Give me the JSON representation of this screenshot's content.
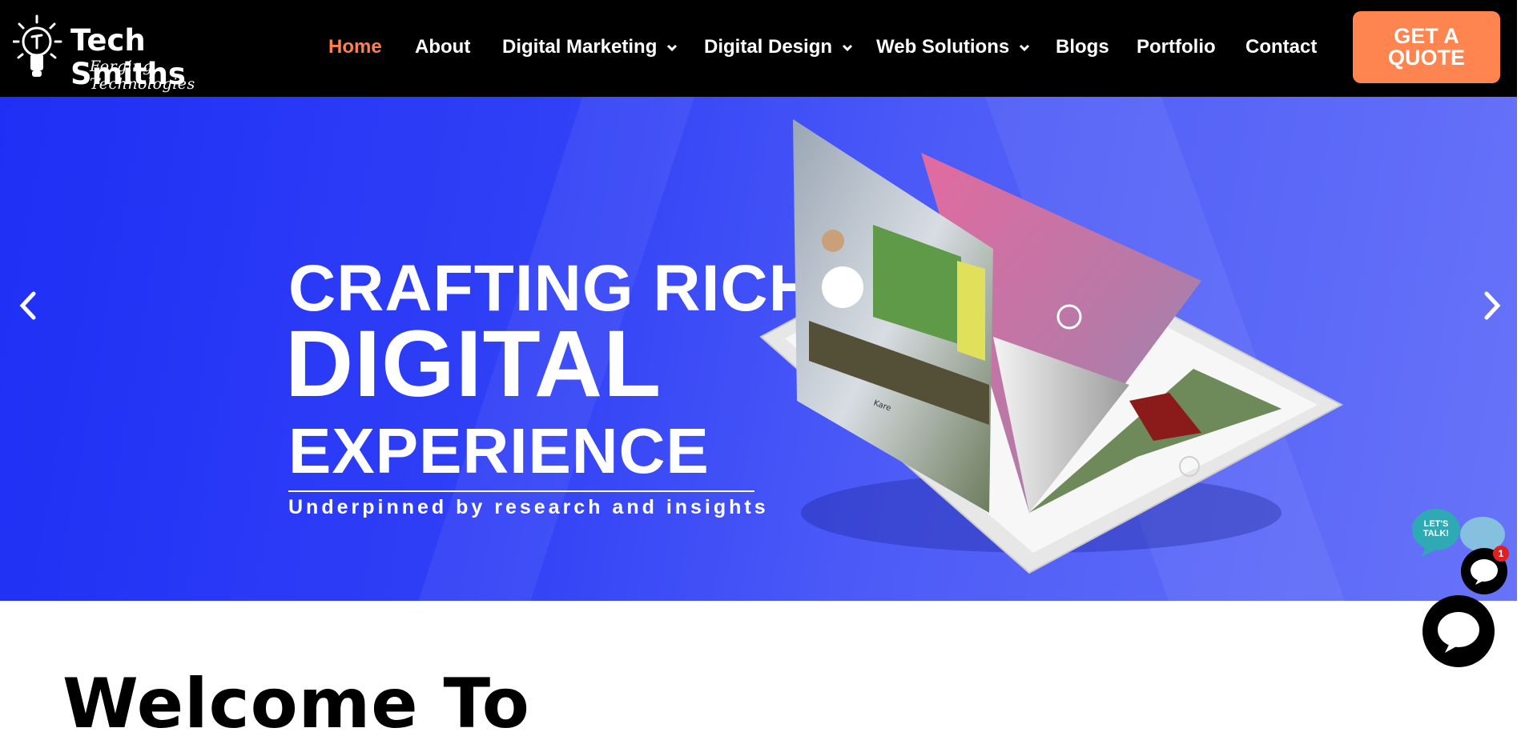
{
  "brand": {
    "name": "Tech Smiths",
    "tagline": "Forging Technologies"
  },
  "nav": {
    "items": [
      {
        "label": "Home",
        "active": true
      },
      {
        "label": "About"
      },
      {
        "label": "Digital Marketing",
        "dropdown": true
      },
      {
        "label": "Digital Design",
        "dropdown": true
      },
      {
        "label": "Web Solutions",
        "dropdown": true
      },
      {
        "label": "Blogs"
      },
      {
        "label": "Portfolio"
      },
      {
        "label": "Contact"
      }
    ],
    "cta_label": "GET A QUOTE"
  },
  "hero": {
    "line1": "CRAFTING RICH",
    "line2": "DIGITAL",
    "line3": "EXPERIENCE",
    "subtitle": "Underpinned by research and insights"
  },
  "welcome": {
    "heading": "Welcome To"
  },
  "chat": {
    "lets_talk": "LET'S TALK!",
    "badge_count": "1"
  },
  "colors": {
    "header_bg": "#000000",
    "accent": "#ff7f50",
    "cta_bg": "#ff8550",
    "hero_blue": "#2f3ff5"
  },
  "icons": {
    "prev": "chevron-left-icon",
    "next": "chevron-right-icon",
    "dropdown": "chevron-down-icon",
    "chat": "chat-bubble-icon"
  }
}
